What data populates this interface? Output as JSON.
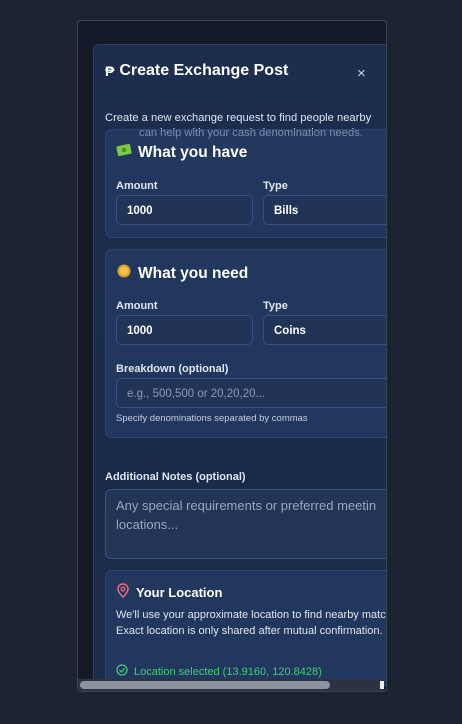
{
  "modal": {
    "title": "Create Exchange Post",
    "title_icon": "peso-sign",
    "close": "×",
    "subtitle_line1": "Create a new exchange request to find people nearby",
    "subtitle_line2": "can help with your cash denomination needs."
  },
  "have": {
    "icon": "cash-icon",
    "title": "What you have",
    "amount_label": "Amount",
    "amount_value": "1000",
    "type_label": "Type",
    "type_value": "Bills"
  },
  "need": {
    "icon": "coin-icon",
    "title": "What you need",
    "amount_label": "Amount",
    "amount_value": "1000",
    "type_label": "Type",
    "type_value": "Coins",
    "breakdown_label": "Breakdown (optional)",
    "breakdown_placeholder": "e.g., 500,500 or 20,20,20...",
    "breakdown_help": "Specify denominations separated by commas"
  },
  "notes": {
    "label": "Additional Notes (optional)",
    "placeholder_line1": "Any special requirements or preferred meetin",
    "placeholder_line2": "locations..."
  },
  "location": {
    "icon": "map-pin-icon",
    "title": "Your Location",
    "description": "We'll use your approximate location to find nearby matches. Exact location is only shared after mutual confirmation.",
    "status": "Location selected (13.9160, 120.8428)",
    "status_color": "#3fcf72"
  },
  "colors": {
    "accent": "#3b82f6",
    "modal_bg": "#1c2d4d"
  }
}
